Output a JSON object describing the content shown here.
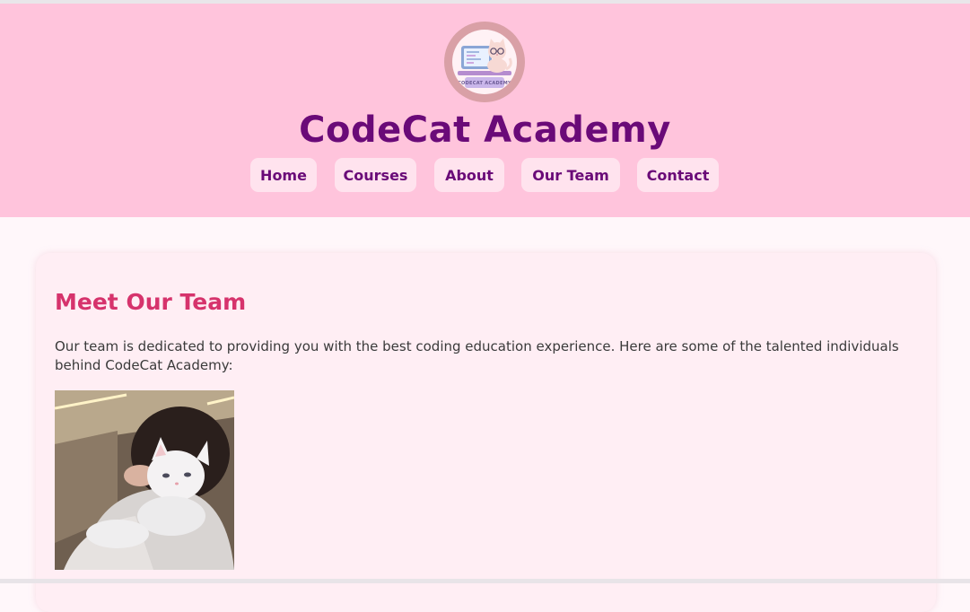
{
  "header": {
    "logo_text": "CODECAT ACADEMY",
    "title": "CodeCat Academy"
  },
  "nav": {
    "items": [
      {
        "label": "Home"
      },
      {
        "label": "Courses"
      },
      {
        "label": "About"
      },
      {
        "label": "Our Team"
      },
      {
        "label": "Contact"
      }
    ]
  },
  "team": {
    "heading": "Meet Our Team",
    "intro": "Our team is dedicated to providing you with the best coding education experience. Here are some of the talented individuals behind CodeCat Academy:",
    "photo_icon": "team-member-with-cat-photo"
  },
  "colors": {
    "header_bg": "#ffc4dc",
    "title": "#6a0a78",
    "nav_button_bg": "#ffe3ee",
    "heading": "#d6336c",
    "card_bg": "#ffeef4",
    "page_bg": "#fff7fa"
  }
}
